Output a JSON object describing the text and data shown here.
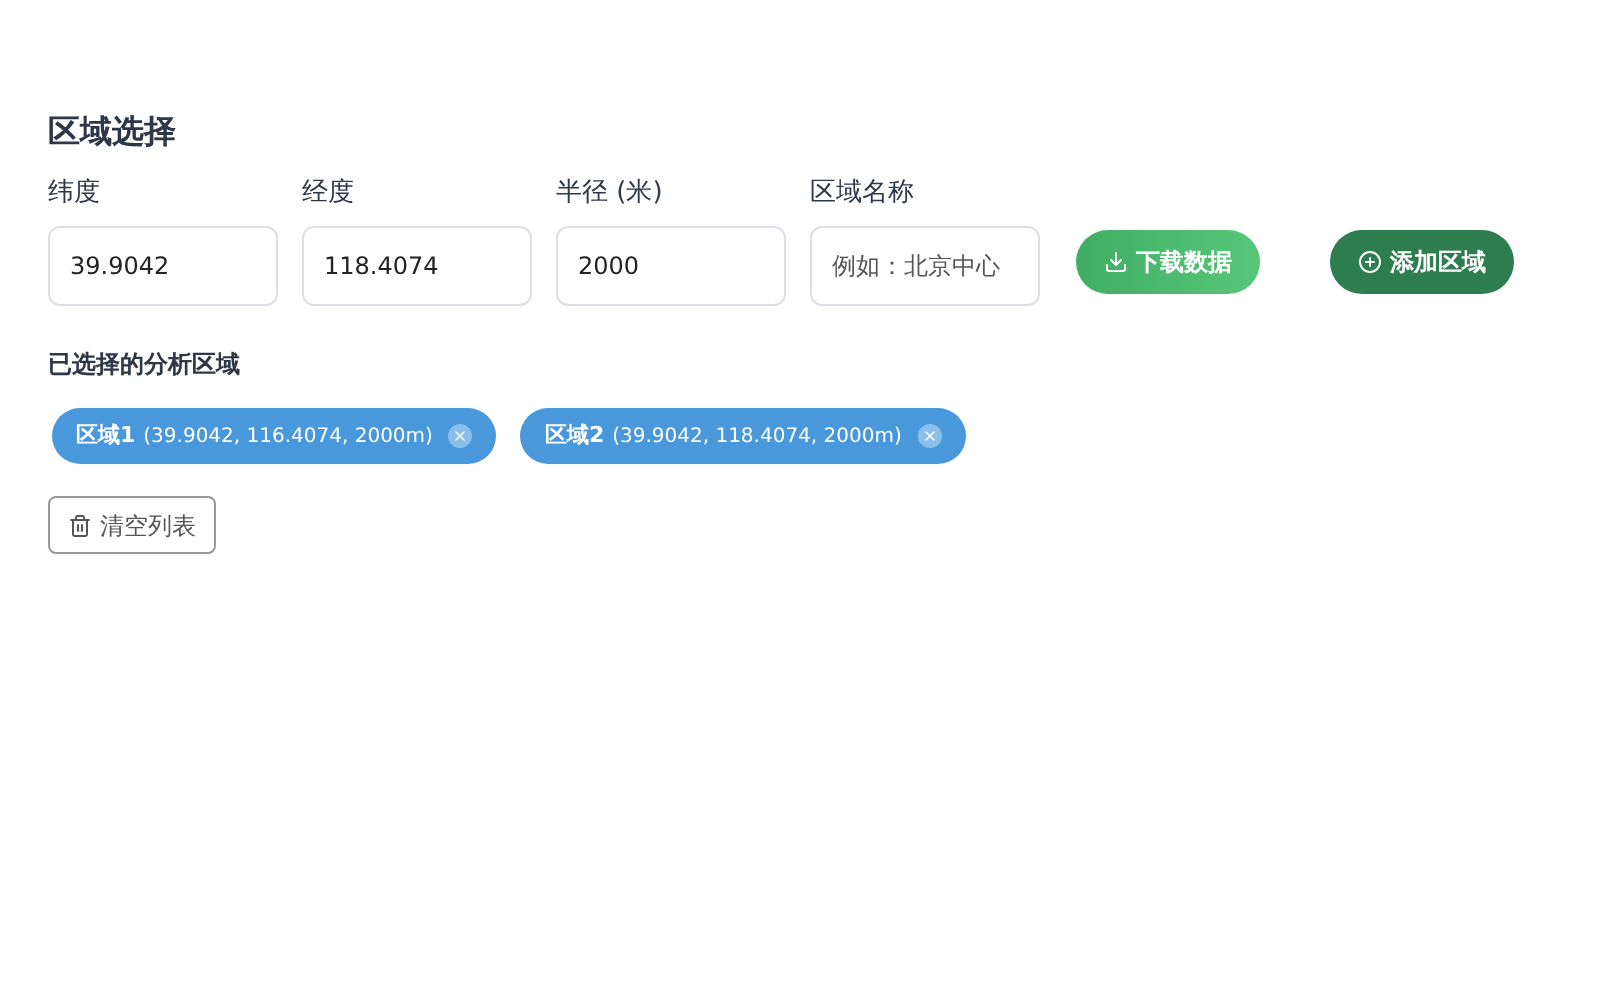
{
  "title": "区域选择",
  "fields": [
    {
      "label": "纬度",
      "value": "39.9042"
    },
    {
      "label": "经度",
      "value": "118.4074"
    },
    {
      "label": "半径 (米)",
      "value": "2000"
    },
    {
      "label": "区域名称",
      "placeholder": "例如：北京中心"
    }
  ],
  "buttons": [
    {
      "kind": "download",
      "label": "下载数据"
    },
    {
      "kind": "add",
      "label": "添加区域"
    }
  ],
  "selected_title": "已选择的分析区域",
  "regions": [
    {
      "name": "区域1",
      "detail": "(39.9042, 116.4074, 2000m)"
    },
    {
      "name": "区域2",
      "detail": "(39.9042, 118.4074, 2000m)"
    }
  ],
  "clear_button": "清空列表"
}
